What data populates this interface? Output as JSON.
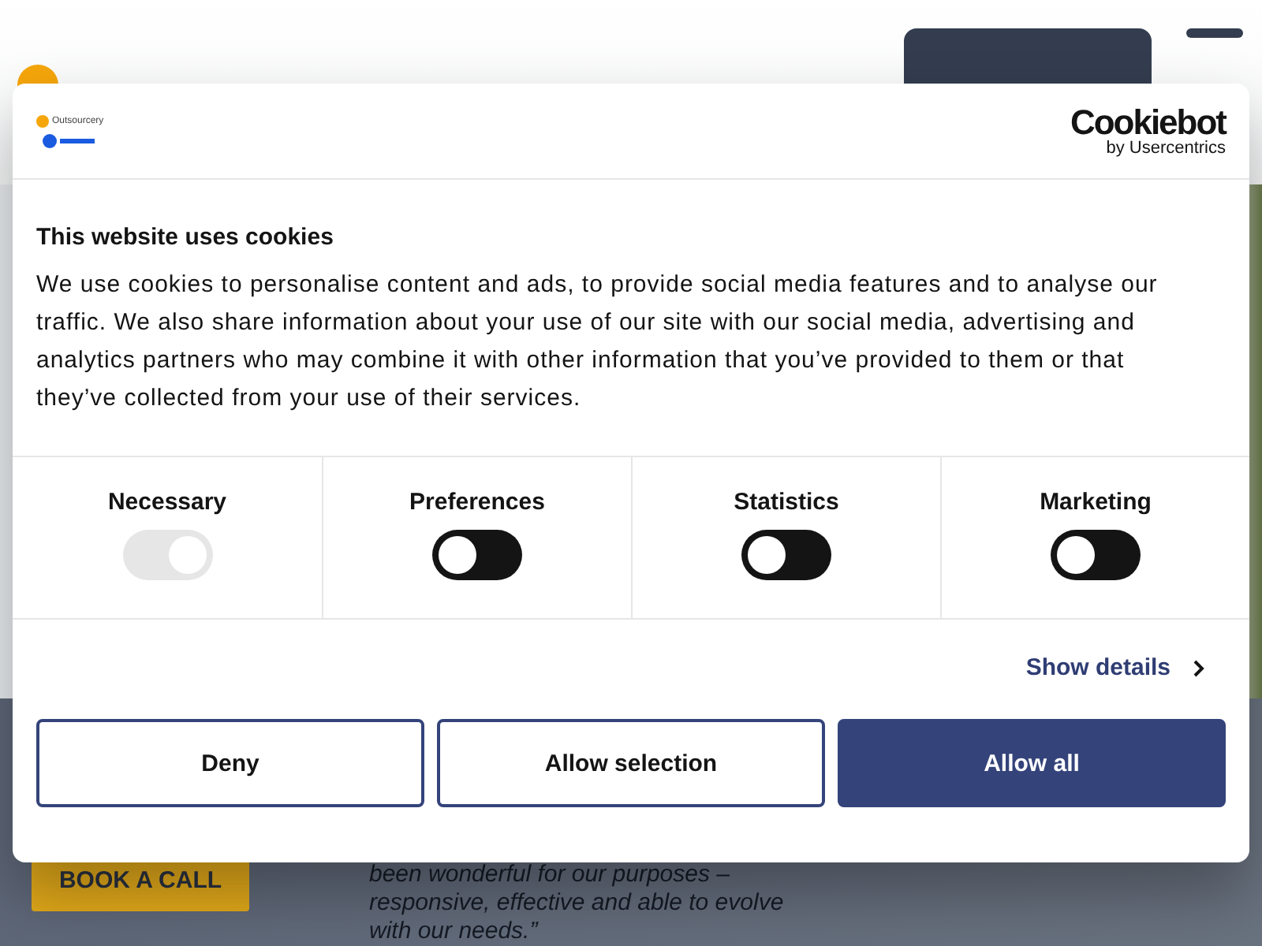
{
  "page": {
    "cta": "BOOK A CALL",
    "quote": "been wonderful for our purposes –\nresponsive, effective and able to evolve\nwith our needs.”"
  },
  "dialog": {
    "logo_text": "Outsourcery",
    "brand": "Cookiebot",
    "brand_sub": "by Usercentrics",
    "title": "This website uses cookies",
    "body": "We use cookies to personalise content and ads, to provide social media features and to analyse our traffic. We also share information about your use of our site with our social media, advertising and analytics partners who may combine it with other information that you’ve provided to them or that they’ve collected from your use of their services.",
    "categories": [
      {
        "label": "Necessary",
        "checked": true,
        "disabled": true
      },
      {
        "label": "Preferences",
        "checked": false,
        "disabled": false
      },
      {
        "label": "Statistics",
        "checked": false,
        "disabled": false
      },
      {
        "label": "Marketing",
        "checked": false,
        "disabled": false
      }
    ],
    "details_link": "Show details",
    "buttons": [
      {
        "label": "Deny",
        "kind": "outline"
      },
      {
        "label": "Allow selection",
        "kind": "outline"
      },
      {
        "label": "Allow all",
        "kind": "primary"
      }
    ]
  }
}
